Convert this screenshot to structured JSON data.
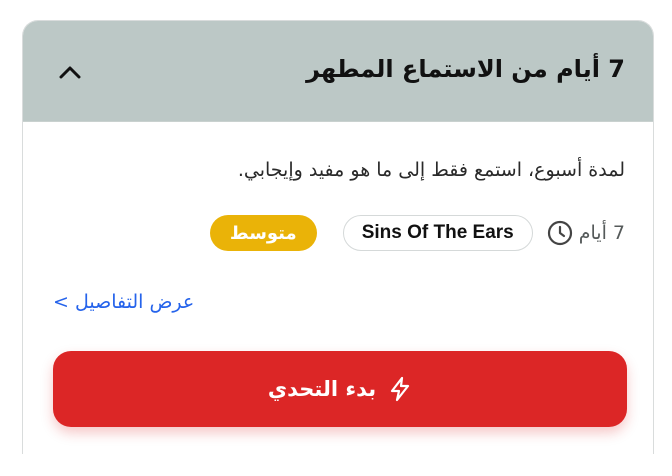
{
  "card": {
    "title": "7 أيام من الاستماع المطهر",
    "description": "لمدة أسبوع، استمع فقط إلى ما هو مفيد وإيجابي.",
    "duration": "7 أيام",
    "tag": "Sins Of The Ears",
    "level": "متوسط",
    "details_link": "عرض التفاصيل >",
    "start_button": "بدء التحدي"
  },
  "icons": {
    "collapse": "chevron-up-icon",
    "duration": "clock-icon",
    "start": "lightning-icon"
  },
  "colors": {
    "header_bg": "#bcc8c6",
    "level_badge": "#eab308",
    "start_button": "#dc2626",
    "link": "#2563eb"
  }
}
